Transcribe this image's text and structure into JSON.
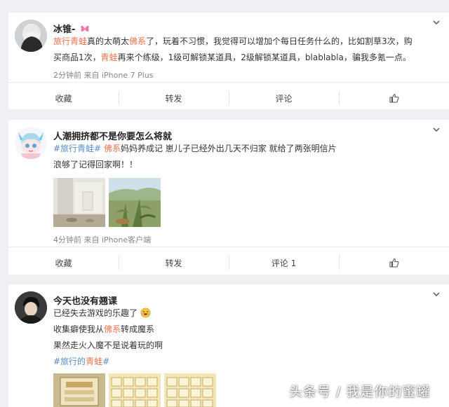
{
  "posts": [
    {
      "user": "冰锥-",
      "lines": [
        [
          {
            "t": "旅行青蛙",
            "c": "hl"
          },
          {
            "t": "真的太萌太"
          },
          {
            "t": "佛系",
            "c": "hl"
          },
          {
            "t": "了，玩着不习惯，我觉得可以增加个每日任务什么的，比如割草3次，购"
          }
        ],
        [
          {
            "t": "买商品1次，"
          },
          {
            "t": "青蛙",
            "c": "hl"
          },
          {
            "t": "再来个练级，1级可解锁某道具，2级解锁某道具，blablabla，骗我多氪一点。"
          }
        ]
      ],
      "meta": "2分钟前 来自 iPhone 7 Plus",
      "actions": {
        "collect": "收藏",
        "forward": "转发",
        "comment": "评论"
      }
    },
    {
      "user": "人潮拥挤都不是你要怎么将就",
      "lines": [
        [
          {
            "t": "#旅行青蛙#",
            "c": "tag"
          },
          {
            "t": " "
          },
          {
            "t": "佛系",
            "c": "hl"
          },
          {
            "t": "妈妈养成记 崽儿子已经外出几天不归家 就给了两张明信片"
          }
        ],
        [
          {
            "t": "浪够了记得回家啊！！"
          }
        ]
      ],
      "meta": "4分钟前 来自 iPhone客户端",
      "actions": {
        "collect": "收藏",
        "forward": "转发",
        "comment": "评论 1"
      }
    },
    {
      "user": "今天也没有翘课",
      "lines": [
        [
          {
            "t": "已经失去游戏的乐趣了"
          }
        ],
        [
          {
            "t": "收集癖使我从"
          },
          {
            "t": "佛系",
            "c": "hl"
          },
          {
            "t": "转成魔系"
          }
        ],
        [
          {
            "t": "果然走火入魔不是说着玩的啊"
          }
        ],
        [
          {
            "t": "#旅行的",
            "c": "tag"
          },
          {
            "t": "青蛙",
            "c": "hl"
          },
          {
            "t": "#",
            "c": "tag"
          }
        ]
      ]
    }
  ],
  "watermark": "头条号 / 我是你的蜜罐"
}
